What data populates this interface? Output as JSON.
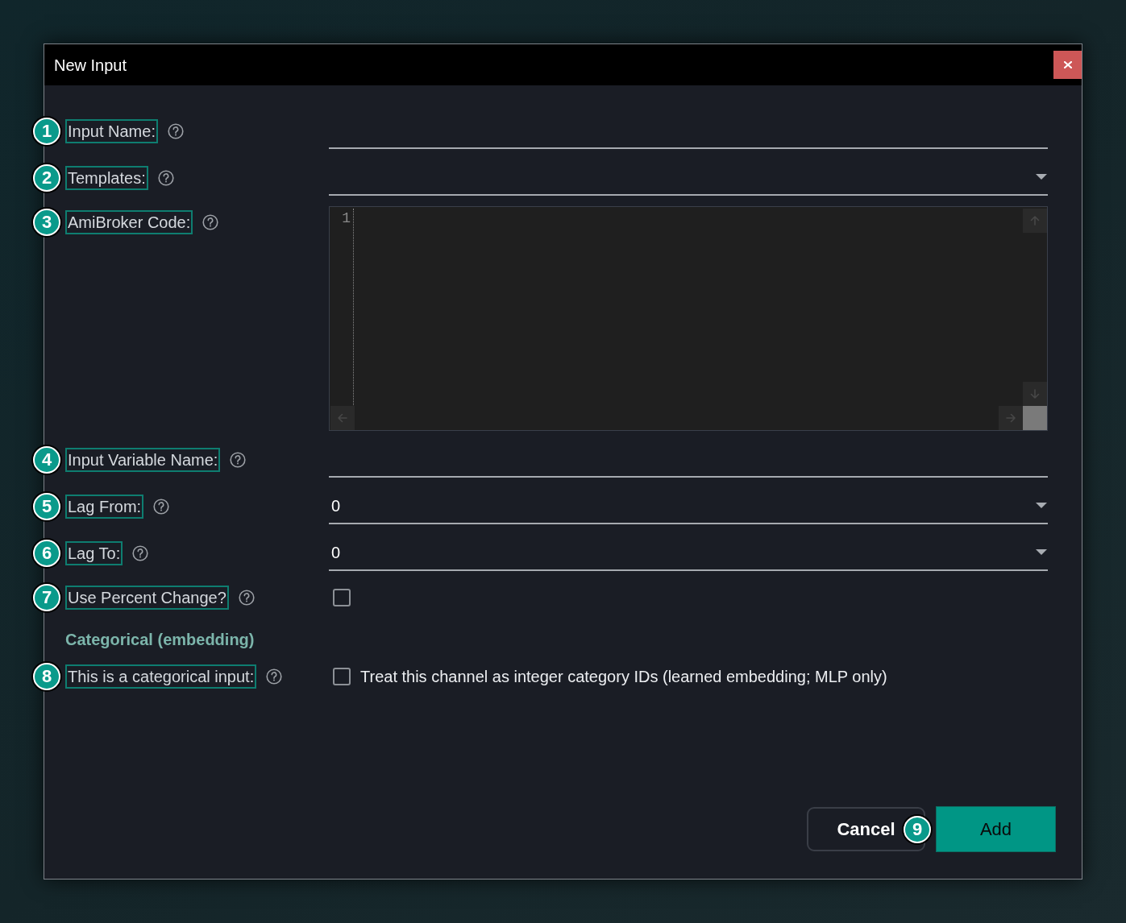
{
  "dialog": {
    "title": "New Input"
  },
  "fields": [
    {
      "kind": "text",
      "callout": "1",
      "label": "Input Name:"
    },
    {
      "kind": "dropdown",
      "callout": "2",
      "label": "Templates:"
    },
    {
      "kind": "code",
      "callout": "3",
      "label": "AmiBroker Code:",
      "line_numbers": [
        "1"
      ]
    },
    {
      "kind": "text",
      "callout": "4",
      "label": "Input Variable Name:"
    },
    {
      "kind": "dropdown",
      "callout": "5",
      "label": "Lag From:",
      "value": "0"
    },
    {
      "kind": "dropdown",
      "callout": "6",
      "label": "Lag To:",
      "value": "0"
    },
    {
      "kind": "checkbox",
      "callout": "7",
      "label": "Use Percent Change?",
      "checked": false
    },
    {
      "kind": "heading",
      "label": "Categorical (embedding)"
    },
    {
      "kind": "checkbox",
      "callout": "8",
      "label": "This is a categorical input:",
      "checked": false,
      "text": "Treat this channel as integer category IDs (learned embedding; MLP only)"
    }
  ],
  "buttons": [
    {
      "kind": "secondary",
      "label": "Cancel",
      "callout": "9"
    },
    {
      "kind": "primary",
      "label": "Add"
    }
  ]
}
